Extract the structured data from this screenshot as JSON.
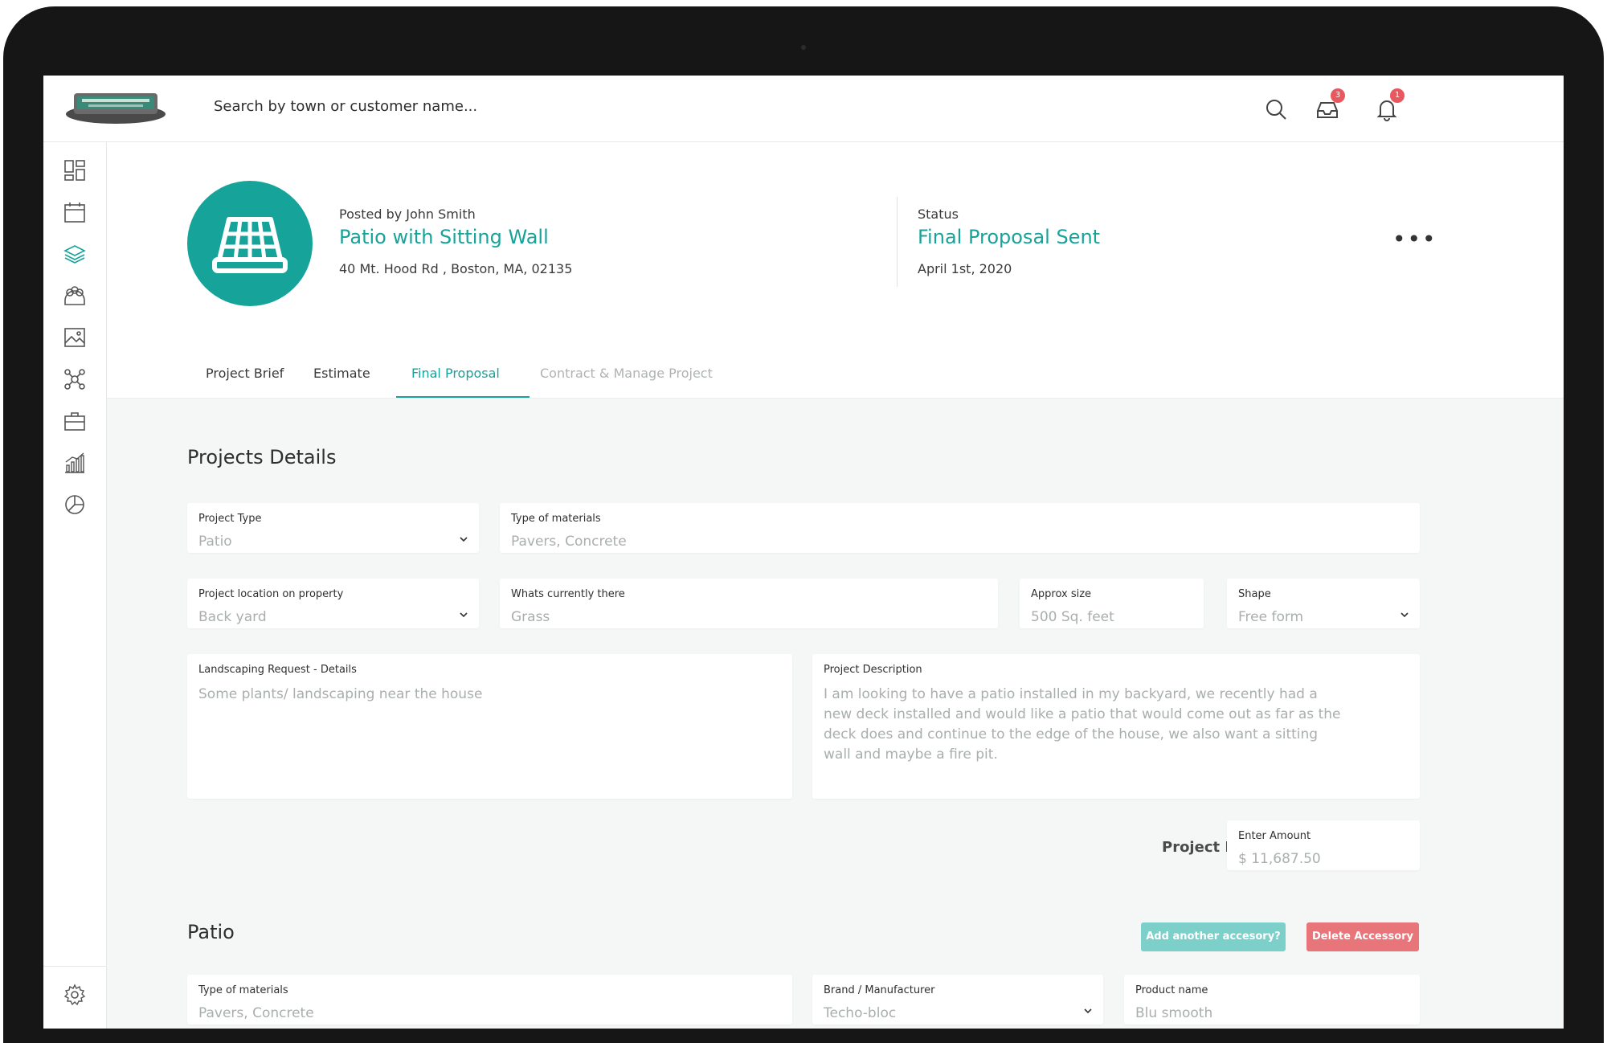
{
  "app": {
    "logo_alt": "J&D Landscaping",
    "search_placeholder": "Search by town or customer name..."
  },
  "topbar": {
    "inbox_count": "3",
    "notification_count": "1"
  },
  "sidebar": {
    "items": [
      "dashboard-icon",
      "calendar-icon",
      "layers-icon",
      "team-icon",
      "gallery-icon",
      "network-icon",
      "briefcase-icon",
      "analytics-icon",
      "pie-icon"
    ],
    "settings": "settings-icon"
  },
  "project": {
    "posted_by": "Posted by John Smith",
    "title": "Patio with Sitting Wall",
    "address": "40 Mt. Hood Rd , Boston, MA, 02135",
    "status_label": "Status",
    "status": "Final Proposal Sent",
    "status_date": "April 1st, 2020"
  },
  "tabs": [
    {
      "label": "Project Brief"
    },
    {
      "label": "Estimate"
    },
    {
      "label": "Final Proposal"
    },
    {
      "label": "Contract & Manage Project"
    }
  ],
  "details": {
    "title": "Projects Details",
    "project_type": {
      "label": "Project Type",
      "value": "Patio"
    },
    "materials": {
      "label": "Type of materials",
      "value": "Pavers, Concrete"
    },
    "location": {
      "label": "Project location on property",
      "value": "Back yard"
    },
    "current": {
      "label": "Whats currently there",
      "value": "Grass"
    },
    "size": {
      "label": "Approx size",
      "value": "500 Sq. feet"
    },
    "shape": {
      "label": "Shape",
      "value": "Free form"
    },
    "request": {
      "label": "Landscaping Request - Details",
      "value": "Some plants/ landscaping near the house"
    },
    "description": {
      "label": "Project Description",
      "value": "I am looking to have a patio installed in my backyard, we recently had a new deck installed and would like a patio that would come out as far as the deck does and continue to the edge of the house, we also want a sitting wall and maybe a fire pit."
    },
    "price_label": "Project  Price",
    "amount": {
      "label": "Enter Amount",
      "value": "$ 11,687.50"
    }
  },
  "patio": {
    "title": "Patio",
    "add_button": "Add another accesory?",
    "delete_button": "Delete Accessory",
    "materials": {
      "label": "Type of materials",
      "value": "Pavers, Concrete"
    },
    "brand": {
      "label": "Brand / Manufacturer",
      "value": "Techo-bloc"
    },
    "product": {
      "label": "Product name",
      "value": "Blu smooth"
    }
  },
  "colors": {
    "accent": "#16a399",
    "badge": "#e8585f",
    "button_teal": "#7dcfca",
    "button_red": "#e8757a"
  }
}
